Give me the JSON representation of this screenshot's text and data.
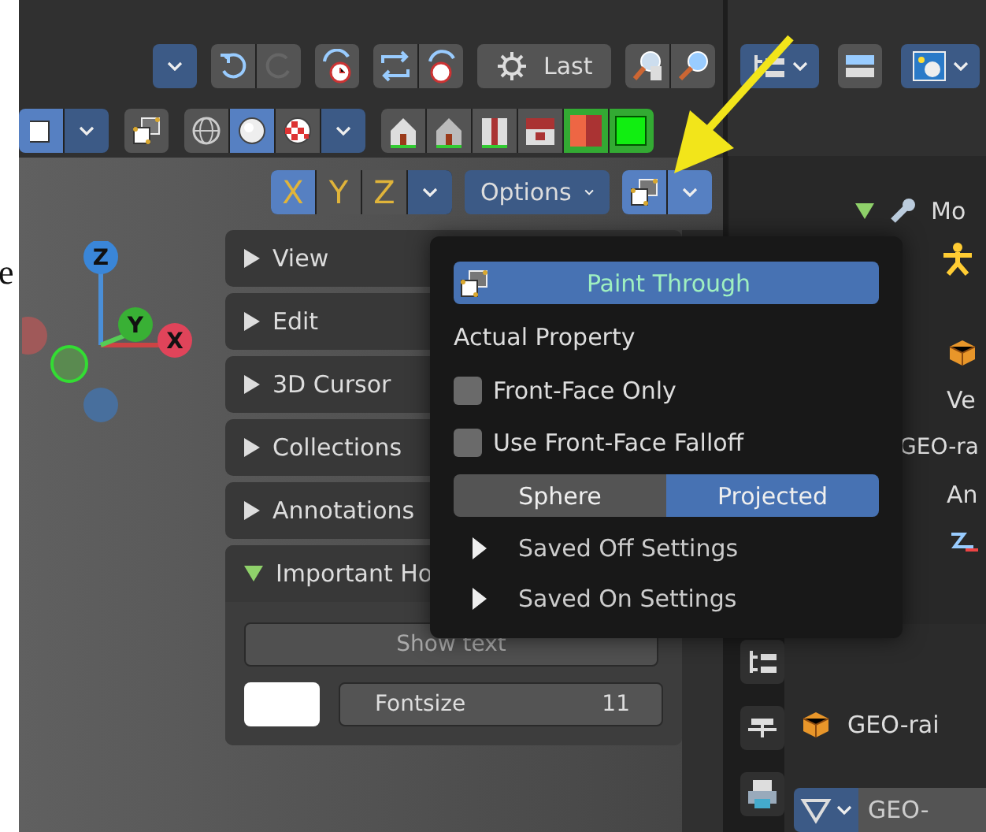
{
  "left_margin_text": "e",
  "header": {
    "last_button": "Last",
    "paint_through_toggle": {
      "on": true
    }
  },
  "shading_modes": [
    {
      "kind": "wireframe",
      "selected": false
    },
    {
      "kind": "solid",
      "selected": true
    },
    {
      "kind": "material",
      "selected": false
    }
  ],
  "axis_toggles": [
    {
      "label": "X",
      "selected": true
    },
    {
      "label": "Y",
      "selected": false
    },
    {
      "label": "Z",
      "selected": false
    }
  ],
  "options_button": "Options",
  "gizmo": {
    "axes": [
      {
        "label": "Z"
      },
      {
        "label": "Y"
      },
      {
        "label": "X"
      }
    ]
  },
  "sidebar": {
    "panels": [
      {
        "label": "View",
        "expanded": false
      },
      {
        "label": "Edit",
        "expanded": false
      },
      {
        "label": "3D Cursor",
        "expanded": false
      },
      {
        "label": "Collections",
        "expanded": false
      },
      {
        "label": "Annotations",
        "expanded": false
      },
      {
        "label": "Important Ho",
        "expanded": true
      }
    ],
    "show_text_button": "Show text",
    "fontsize": {
      "label": "Fontsize",
      "value": "11"
    }
  },
  "popup": {
    "paint_through": {
      "label": "Paint Through",
      "on": true
    },
    "section_label": "Actual Property",
    "checkboxes": [
      {
        "label": "Front-Face Only",
        "checked": false
      },
      {
        "label": "Use Front-Face Falloff",
        "checked": false
      }
    ],
    "falloff_shape": [
      {
        "label": "Sphere",
        "selected": false
      },
      {
        "label": "Projected",
        "selected": true
      }
    ],
    "subpanels": [
      {
        "label": "Saved Off Settings",
        "expanded": false
      },
      {
        "label": "Saved On Settings",
        "expanded": false
      }
    ]
  },
  "outliner": {
    "rows": [
      "Mo",
      "Ve",
      "GEO-ra",
      "An"
    ]
  },
  "properties": {
    "object_name": "GEO-rai",
    "mesh_name": "GEO-"
  }
}
